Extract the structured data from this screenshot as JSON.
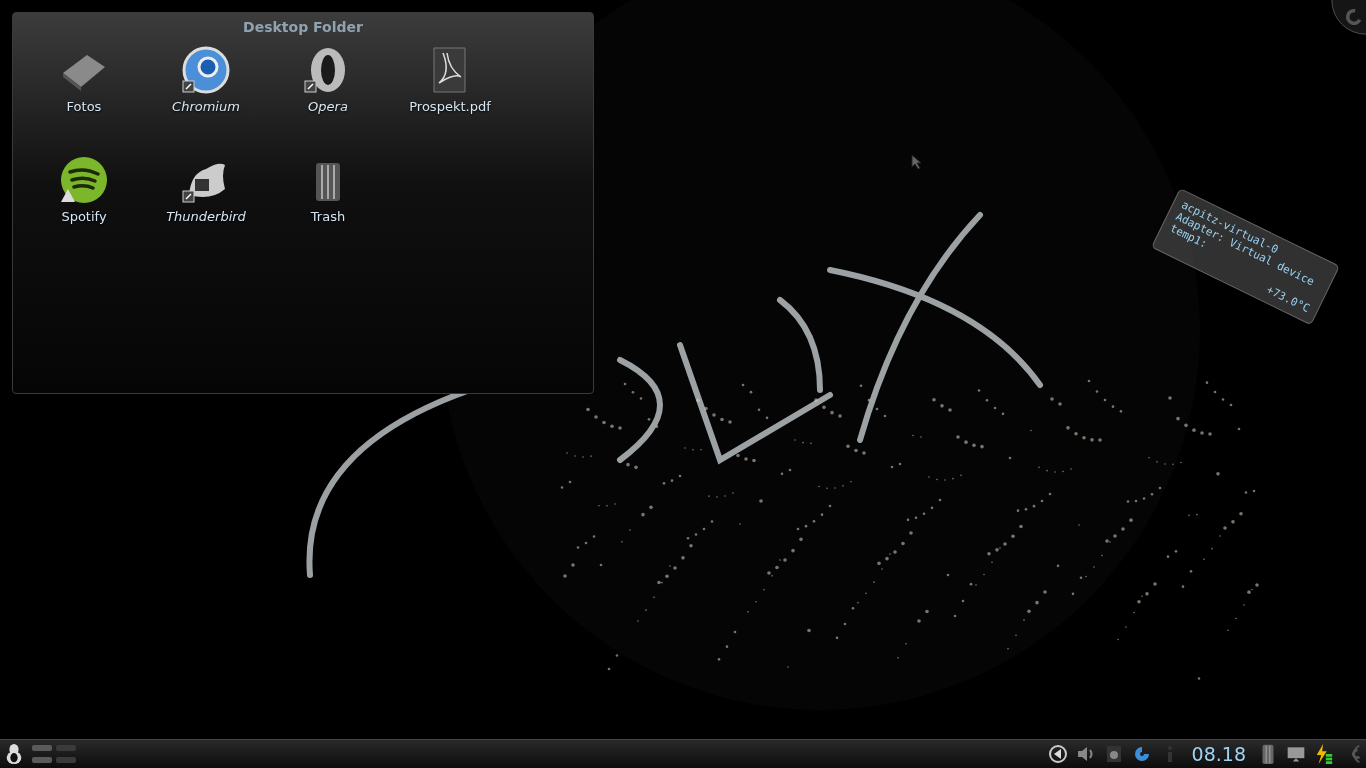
{
  "folder_view": {
    "title": "Desktop Folder",
    "items": [
      {
        "label": "Fotos",
        "kind": "folder",
        "link": false,
        "warning": false
      },
      {
        "label": "Chromium",
        "kind": "browser",
        "link": true,
        "warning": false
      },
      {
        "label": "Opera",
        "kind": "opera",
        "link": true,
        "warning": false
      },
      {
        "label": "Prospekt.pdf",
        "kind": "pdf",
        "link": false,
        "warning": false
      },
      {
        "label": "Spotify",
        "kind": "music",
        "link": false,
        "warning": true
      },
      {
        "label": "Thunderbird",
        "kind": "mail",
        "link": true,
        "warning": false
      },
      {
        "label": "Trash",
        "kind": "trash",
        "link": false,
        "warning": false
      }
    ]
  },
  "sensor_widget": {
    "lines": [
      "acpitz-virtual-0",
      "Adapter: Virtual device"
    ],
    "label": "temp1:",
    "value": "+73.0°C"
  },
  "taskbar": {
    "clock": "08.18",
    "pager": [
      {
        "selected": true
      },
      {
        "selected": false
      }
    ]
  }
}
